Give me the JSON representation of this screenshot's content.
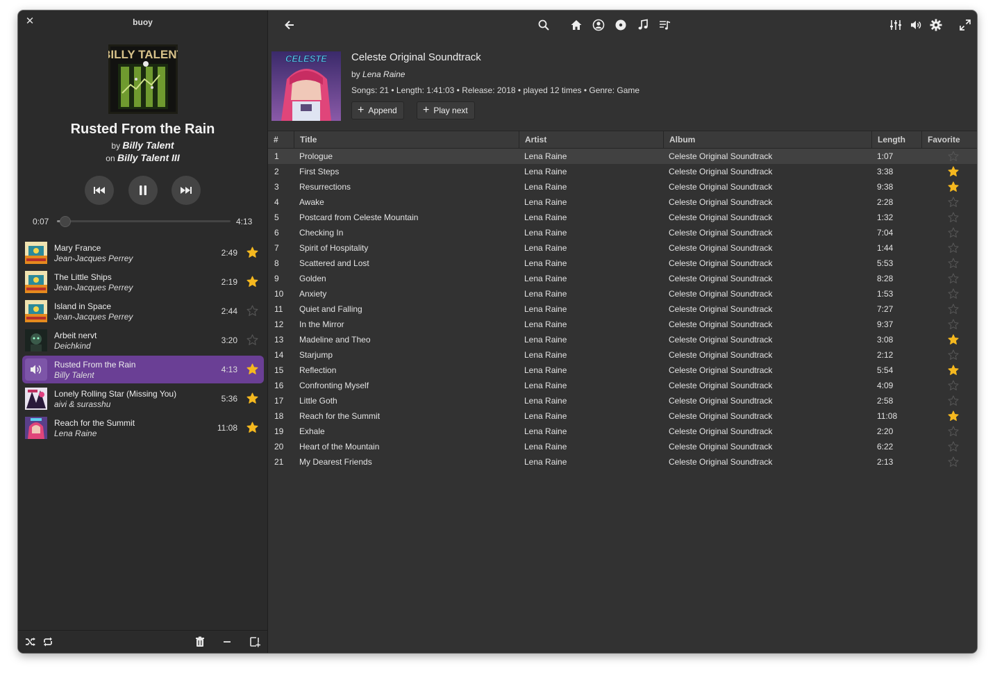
{
  "app": {
    "title": "buoy"
  },
  "now_playing": {
    "title": "Rusted From the Rain",
    "by_prefix": "by",
    "artist": "Billy Talent",
    "on_prefix": "on",
    "album": "Billy Talent III",
    "elapsed": "0:07",
    "duration": "4:13",
    "progress_fraction": 0.028
  },
  "queue": [
    {
      "title": "Mary France",
      "artist": "Jean-Jacques Perrey",
      "length": "2:49",
      "favorite": true,
      "active": false,
      "art": "perrey"
    },
    {
      "title": "The Little Ships",
      "artist": "Jean-Jacques Perrey",
      "length": "2:19",
      "favorite": true,
      "active": false,
      "art": "perrey"
    },
    {
      "title": "Island in Space",
      "artist": "Jean-Jacques Perrey",
      "length": "2:44",
      "favorite": false,
      "active": false,
      "art": "perrey"
    },
    {
      "title": "Arbeit nervt",
      "artist": "Deichkind",
      "length": "3:20",
      "favorite": false,
      "active": false,
      "art": "deichkind"
    },
    {
      "title": "Rusted From the Rain",
      "artist": "Billy Talent",
      "length": "4:13",
      "favorite": true,
      "active": true,
      "art": "speaker"
    },
    {
      "title": "Lonely Rolling Star (Missing You)",
      "artist": "aivi & surasshu",
      "length": "5:36",
      "favorite": true,
      "active": false,
      "art": "aivi"
    },
    {
      "title": "Reach for the Summit",
      "artist": "Lena Raine",
      "length": "11:08",
      "favorite": true,
      "active": false,
      "art": "celeste"
    }
  ],
  "album": {
    "title": "Celeste Original Soundtrack",
    "by_prefix": "by",
    "artist": "Lena Raine",
    "meta": "Songs: 21 • Length: 1:41:03 • Release: 2018 • played 12 times • Genre: Game",
    "append_label": "Append",
    "play_next_label": "Play next",
    "cover_text": "CELESTE"
  },
  "table": {
    "columns": {
      "num": "#",
      "title": "Title",
      "artist": "Artist",
      "album": "Album",
      "length": "Length",
      "favorite": "Favorite"
    },
    "rows": [
      {
        "num": "1",
        "title": "Prologue",
        "artist": "Lena Raine",
        "album": "Celeste Original Soundtrack",
        "length": "1:07",
        "favorite": false,
        "selected": true
      },
      {
        "num": "2",
        "title": "First Steps",
        "artist": "Lena Raine",
        "album": "Celeste Original Soundtrack",
        "length": "3:38",
        "favorite": true
      },
      {
        "num": "3",
        "title": "Resurrections",
        "artist": "Lena Raine",
        "album": "Celeste Original Soundtrack",
        "length": "9:38",
        "favorite": true
      },
      {
        "num": "4",
        "title": "Awake",
        "artist": "Lena Raine",
        "album": "Celeste Original Soundtrack",
        "length": "2:28",
        "favorite": false
      },
      {
        "num": "5",
        "title": "Postcard from Celeste Mountain",
        "artist": "Lena Raine",
        "album": "Celeste Original Soundtrack",
        "length": "1:32",
        "favorite": false
      },
      {
        "num": "6",
        "title": "Checking In",
        "artist": "Lena Raine",
        "album": "Celeste Original Soundtrack",
        "length": "7:04",
        "favorite": false
      },
      {
        "num": "7",
        "title": "Spirit of Hospitality",
        "artist": "Lena Raine",
        "album": "Celeste Original Soundtrack",
        "length": "1:44",
        "favorite": false
      },
      {
        "num": "8",
        "title": "Scattered and Lost",
        "artist": "Lena Raine",
        "album": "Celeste Original Soundtrack",
        "length": "5:53",
        "favorite": false
      },
      {
        "num": "9",
        "title": "Golden",
        "artist": "Lena Raine",
        "album": "Celeste Original Soundtrack",
        "length": "8:28",
        "favorite": false
      },
      {
        "num": "10",
        "title": "Anxiety",
        "artist": "Lena Raine",
        "album": "Celeste Original Soundtrack",
        "length": "1:53",
        "favorite": false
      },
      {
        "num": "11",
        "title": "Quiet and Falling",
        "artist": "Lena Raine",
        "album": "Celeste Original Soundtrack",
        "length": "7:27",
        "favorite": false
      },
      {
        "num": "12",
        "title": "In the Mirror",
        "artist": "Lena Raine",
        "album": "Celeste Original Soundtrack",
        "length": "9:37",
        "favorite": false
      },
      {
        "num": "13",
        "title": "Madeline and Theo",
        "artist": "Lena Raine",
        "album": "Celeste Original Soundtrack",
        "length": "3:08",
        "favorite": true
      },
      {
        "num": "14",
        "title": "Starjump",
        "artist": "Lena Raine",
        "album": "Celeste Original Soundtrack",
        "length": "2:12",
        "favorite": false
      },
      {
        "num": "15",
        "title": "Reflection",
        "artist": "Lena Raine",
        "album": "Celeste Original Soundtrack",
        "length": "5:54",
        "favorite": true
      },
      {
        "num": "16",
        "title": "Confronting Myself",
        "artist": "Lena Raine",
        "album": "Celeste Original Soundtrack",
        "length": "4:09",
        "favorite": false
      },
      {
        "num": "17",
        "title": "Little Goth",
        "artist": "Lena Raine",
        "album": "Celeste Original Soundtrack",
        "length": "2:58",
        "favorite": false
      },
      {
        "num": "18",
        "title": "Reach for the Summit",
        "artist": "Lena Raine",
        "album": "Celeste Original Soundtrack",
        "length": "11:08",
        "favorite": true
      },
      {
        "num": "19",
        "title": "Exhale",
        "artist": "Lena Raine",
        "album": "Celeste Original Soundtrack",
        "length": "2:20",
        "favorite": false
      },
      {
        "num": "20",
        "title": "Heart of the Mountain",
        "artist": "Lena Raine",
        "album": "Celeste Original Soundtrack",
        "length": "6:22",
        "favorite": false
      },
      {
        "num": "21",
        "title": "My Dearest Friends",
        "artist": "Lena Raine",
        "album": "Celeste Original Soundtrack",
        "length": "2:13",
        "favorite": false
      }
    ]
  },
  "icons": {
    "top_left": [
      "back-arrow-icon"
    ],
    "top_center": [
      "search-icon",
      "home-icon",
      "artist-icon",
      "album-disc-icon",
      "music-note-icon",
      "playlist-icon"
    ],
    "top_right": [
      "equalizer-icon",
      "volume-icon",
      "settings-icon",
      "fullscreen-icon"
    ],
    "sidebar_bottom": [
      "shuffle-icon",
      "repeat-icon",
      "trash-icon",
      "minus-icon",
      "add-to-playlist-icon"
    ]
  },
  "colors": {
    "accent": "#6a3f95",
    "star": "#f5b81f",
    "window_bg": "#2e2e2e",
    "sidebar_bg": "#2b2b2b",
    "main_bg": "#323232"
  }
}
